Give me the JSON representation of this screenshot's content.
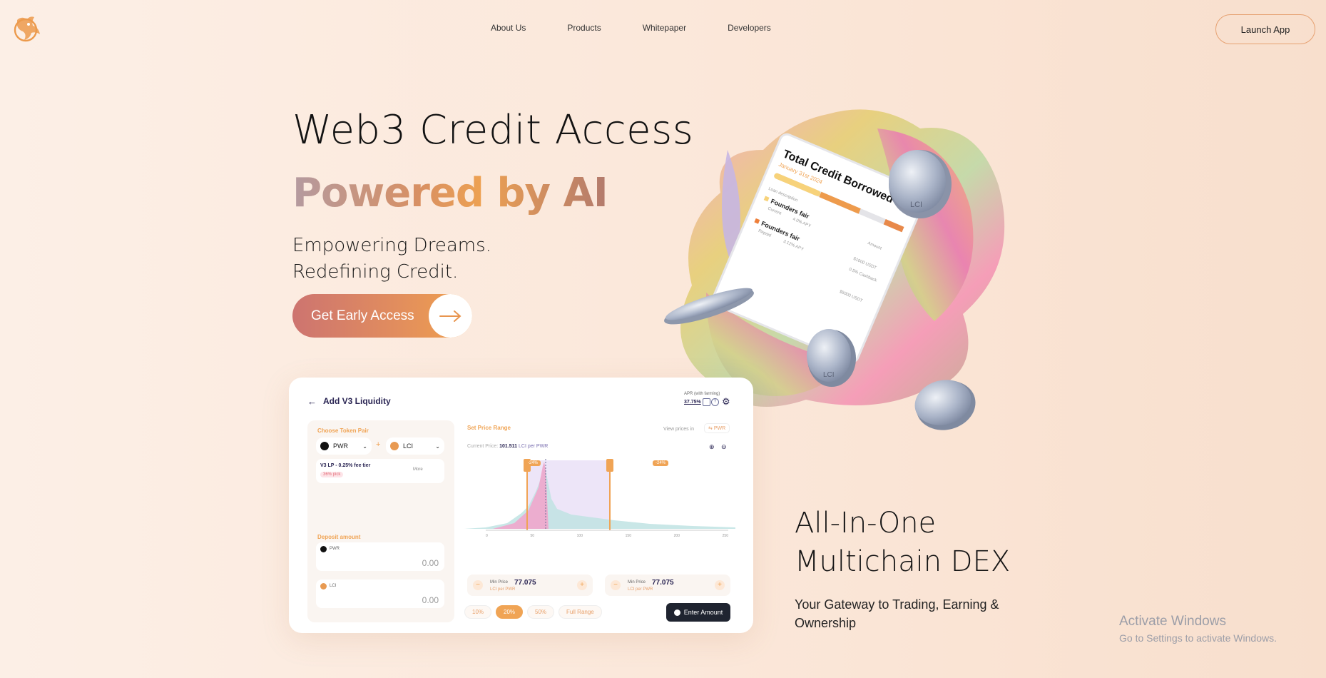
{
  "nav": {
    "logo_icon": "phoenix-logo-icon",
    "items": [
      {
        "label": "About Us"
      },
      {
        "label": "Products"
      },
      {
        "label": "Whitepaper"
      },
      {
        "label": "Developers"
      }
    ],
    "launch_label": "Launch App"
  },
  "hero": {
    "title": "Web3 Credit Access",
    "title_accent": "Powered by AI",
    "sub_line1": "Empowering Dreams.",
    "sub_line2": "Redefining Credit.",
    "cta_label": "Get Early Access"
  },
  "art_card": {
    "title": "Total Credit Borrowed",
    "date": "January 31st 2024",
    "loan_desc": "Loan description",
    "row1_title": "Founders fair",
    "row1_status": "Current",
    "row1_apy": "4.0% APY",
    "row2_title": "Founders fair",
    "row2_status": "Repaid",
    "row2_apy": "3.12% APY",
    "amount_label": "Amount",
    "amount1": "$1000 USDT",
    "cashback": "0.5% Cashback",
    "amount2": "$5000 USDT",
    "coin_label": "LCI"
  },
  "liquidity_card": {
    "title": "Add V3 Liquidity",
    "apr_label": "APR (with farming)",
    "apr_value": "37.75%",
    "choose_pair": "Choose Token Pair",
    "token_a": "PWR",
    "token_b": "LCI",
    "fee_tier": "V3 LP - 0.25% fee tier",
    "fee_pick": "36% pick",
    "more": "More",
    "deposit_label": "Deposit amount",
    "deposit_a_token": "PWR",
    "deposit_a_value": "0.00",
    "deposit_b_token": "LCI",
    "deposit_b_value": "0.00",
    "set_range": "Set Price Range",
    "view_prices": "View prices in",
    "view_token": "PWR",
    "current_price_label": "Current Price:",
    "current_price_value": "101.511",
    "current_price_unit": "LCI per PWR",
    "left_pct": "-24%",
    "right_pct": "-24%",
    "axis_ticks": [
      "0",
      "50",
      "100",
      "150",
      "200",
      "250"
    ],
    "min_label": "Min Price",
    "min_value": "77.075",
    "min_unit": "LCI per PWR",
    "max_label": "Min Price",
    "max_value": "77.075",
    "max_unit": "LCI per PWR",
    "ranges": [
      "10%",
      "20%",
      "50%",
      "Full Range"
    ],
    "enter_label": "Enter Amount"
  },
  "dex": {
    "line1": "All-In-One",
    "line2": "Multichain DEX",
    "sub": "Your Gateway to Trading, Earning & Ownership"
  },
  "watermark": {
    "line1": "Activate Windows",
    "line2": "Go to Settings to activate Windows."
  },
  "colors": {
    "accent_orange": "#f0a455",
    "cta_start": "#cd7470",
    "dark_button": "#1f2430"
  }
}
